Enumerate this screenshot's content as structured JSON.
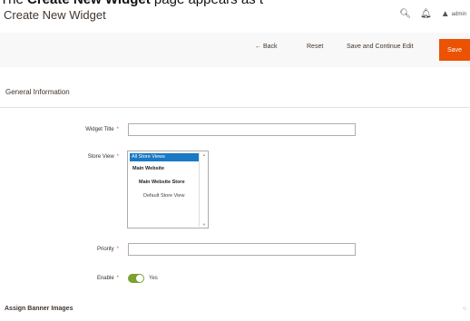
{
  "caption": {
    "prefix": "The ",
    "bold": "Create New Widget",
    "suffix": " page appears as t"
  },
  "header": {
    "title": "Create New Widget",
    "user_label": "admin"
  },
  "toolbar": {
    "back_label": "← Back",
    "reset_label": "Reset",
    "save_continue_label": "Save and Continue Edit",
    "save_label": "Save",
    "save_color": "#eb5202"
  },
  "general": {
    "section_title": "General Information",
    "widget_title_label": "Widget Title",
    "widget_title_value": "",
    "store_view_label": "Store View",
    "store_options": [
      "All Store Views",
      "Main Website",
      "Main Website Store",
      "Default Store View"
    ],
    "store_selected": "All Store Views",
    "priority_label": "Priority",
    "priority_value": "",
    "enable_label": "Enable",
    "enable_value": "Yes",
    "toggle_color": "#79a22e",
    "required_mark": "*"
  },
  "assign": {
    "title": "Assign Banner Images"
  },
  "icons": {
    "search": "search-icon",
    "bell": "bell-icon",
    "user": "user-icon",
    "collapse": "collapse-icon"
  }
}
